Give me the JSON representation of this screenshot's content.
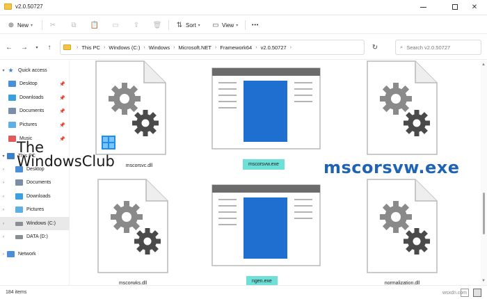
{
  "window": {
    "title": "v2.0.50727"
  },
  "toolbar": {
    "new_label": "New",
    "sort_label": "Sort",
    "view_label": "View",
    "more_label": "•••"
  },
  "address": {
    "crumbs": [
      "This PC",
      "Windows (C:)",
      "Windows",
      "Microsoft.NET",
      "Framework64",
      "v2.0.50727"
    ],
    "search_placeholder": "Search v2.0.50727"
  },
  "sidebar": {
    "items": [
      {
        "label": "Quick access"
      },
      {
        "label": "Desktop"
      },
      {
        "label": "Downloads"
      },
      {
        "label": "Documents"
      },
      {
        "label": "Pictures"
      },
      {
        "label": "Music"
      },
      {
        "label": "This PC"
      },
      {
        "label": "Desktop"
      },
      {
        "label": "Documents"
      },
      {
        "label": "Downloads"
      },
      {
        "label": "Pictures"
      },
      {
        "label": "Windows (C:)"
      },
      {
        "label": "DATA (D:)"
      },
      {
        "label": "Network"
      }
    ]
  },
  "files": [
    {
      "name": "mscorsvc.dll",
      "type": "dll"
    },
    {
      "name": "mscorsvw.exe",
      "type": "exe"
    },
    {
      "name": "",
      "type": "dll"
    },
    {
      "name": "mscorwks.dll",
      "type": "dll"
    },
    {
      "name": "ngen.exe",
      "type": "exe"
    },
    {
      "name": "normalization.dll",
      "type": "dll"
    }
  ],
  "status": {
    "item_count": "184 items"
  },
  "watermark": {
    "logo_line1": "The",
    "logo_line2": "WindowsClub",
    "caption": "mscorsvw.exe",
    "site": "wsxdn.com"
  },
  "colors": {
    "highlight": "#6fe0d8",
    "caption": "#1e63b4",
    "folder": "#f4c542"
  }
}
